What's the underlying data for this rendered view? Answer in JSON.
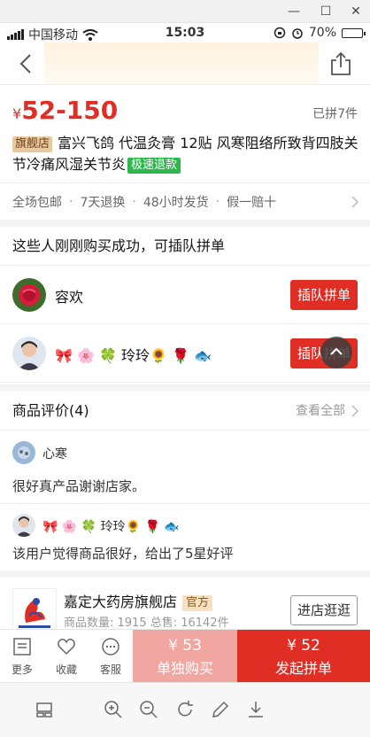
{
  "status_bar": {
    "carrier": "中国移动",
    "time": "15:03",
    "battery": "70%",
    "battery_level": 0.7,
    "icons": [
      "signal-icon",
      "wifi-icon",
      "rotation-lock-icon",
      "alarm-icon",
      "battery-icon"
    ]
  },
  "nav": {
    "icons": [
      "back-icon",
      "share-icon"
    ]
  },
  "product": {
    "price_symbol": "¥",
    "price_range": "52-150",
    "sold": "已拼7件",
    "flag_tag": "旗舰店",
    "title": "富兴飞鸽 代温灸膏 12贴 风寒阻络所致背四肢关节冷痛风湿关节炎",
    "refund_tag": "极速退款"
  },
  "services": [
    "全场包邮",
    "7天退换",
    "48小时发货",
    "假一赔十"
  ],
  "group": {
    "heading": "这些人刚刚购买成功，可插队拼单",
    "rows": [
      {
        "name": "容欢",
        "button": "插队拼单"
      },
      {
        "name": "🎀 🌸 🍀 玲玲🌻 🌹 🐟",
        "button": "插队拼单"
      }
    ]
  },
  "reviews": {
    "heading": "商品评价(4)",
    "view_all": "查看全部",
    "items": [
      {
        "nick": "心寒",
        "text": "很好真产品谢谢店家。"
      },
      {
        "nick": "🎀 🌸 🍀 玲玲🌻 🌹 🐟",
        "text": "该用户觉得商品很好，给出了5星好评"
      }
    ]
  },
  "shop": {
    "name": "嘉定大药房旗舰店",
    "official": "官方",
    "stats": "商品数量: 1915   总售: 16142件",
    "enter": "进店逛逛"
  },
  "actions": {
    "more": "更多",
    "favorite": "收藏",
    "service": "客服",
    "single_price": "¥ 53",
    "single_label": "单独购买",
    "group_price": "¥ 52",
    "group_label": "发起拼单"
  },
  "viewer_toolbar": {
    "icons": [
      "layout-icon",
      "zoom-in-icon",
      "zoom-out-icon",
      "rotate-icon",
      "edit-icon",
      "download-icon"
    ]
  },
  "colors": {
    "accent": "#e02e24",
    "accent_light": "#f2a6a1",
    "refund_green": "#2db84d"
  }
}
